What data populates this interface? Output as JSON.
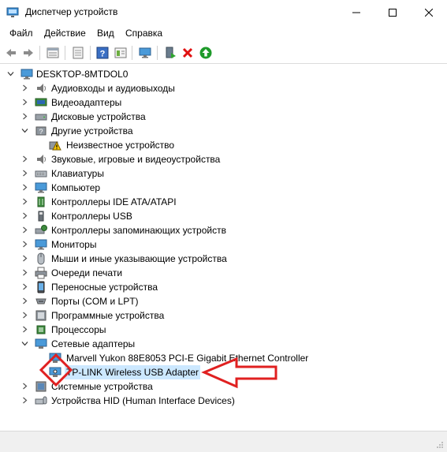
{
  "window": {
    "title": "Диспетчер устройств",
    "controls": [
      "minimize",
      "maximize",
      "close"
    ]
  },
  "menu": [
    "Файл",
    "Действие",
    "Вид",
    "Справка"
  ],
  "toolbar": [
    "back-icon",
    "forward-icon",
    "properties-icon",
    "update-driver-icon",
    "help-icon",
    "view-icon",
    "monitor-icon",
    "scan-hardware-icon",
    "uninstall-icon",
    "enable-device-icon"
  ],
  "tree": {
    "root": "DESKTOP-8MTDOL0",
    "items": [
      {
        "label": "Аудиовходы и аудиовыходы",
        "icon": "audio-icon",
        "expanded": false
      },
      {
        "label": "Видеоадаптеры",
        "icon": "display-adapter-icon",
        "expanded": false
      },
      {
        "label": "Дисковые устройства",
        "icon": "disk-icon",
        "expanded": false
      },
      {
        "label": "Другие устройства",
        "icon": "other-devices-icon",
        "expanded": true,
        "children": [
          {
            "label": "Неизвестное устройство",
            "icon": "warning-device-icon"
          }
        ]
      },
      {
        "label": "Звуковые, игровые и видеоустройства",
        "icon": "sound-icon",
        "expanded": false
      },
      {
        "label": "Клавиатуры",
        "icon": "keyboard-icon",
        "expanded": false
      },
      {
        "label": "Компьютер",
        "icon": "computer-icon",
        "expanded": false
      },
      {
        "label": "Контроллеры IDE ATA/ATAPI",
        "icon": "ide-icon",
        "expanded": false
      },
      {
        "label": "Контроллеры USB",
        "icon": "usb-icon",
        "expanded": false
      },
      {
        "label": "Контроллеры запоминающих устройств",
        "icon": "storage-icon",
        "expanded": false
      },
      {
        "label": "Мониторы",
        "icon": "monitor-icon",
        "expanded": false
      },
      {
        "label": "Мыши и иные указывающие устройства",
        "icon": "mouse-icon",
        "expanded": false
      },
      {
        "label": "Очереди печати",
        "icon": "printer-icon",
        "expanded": false
      },
      {
        "label": "Переносные устройства",
        "icon": "portable-icon",
        "expanded": false
      },
      {
        "label": "Порты (COM и LPT)",
        "icon": "port-icon",
        "expanded": false
      },
      {
        "label": "Программные устройства",
        "icon": "software-icon",
        "expanded": false
      },
      {
        "label": "Процессоры",
        "icon": "cpu-icon",
        "expanded": false
      },
      {
        "label": "Сетевые адаптеры",
        "icon": "network-icon",
        "expanded": true,
        "children": [
          {
            "label": "Marvell Yukon 88E8053 PCI-E Gigabit Ethernet Controller",
            "icon": "network-card-icon"
          },
          {
            "label": "TP-LINK Wireless USB Adapter",
            "icon": "network-card-icon",
            "selected": true
          }
        ]
      },
      {
        "label": "Системные устройства",
        "icon": "system-icon",
        "expanded": false
      },
      {
        "label": "Устройства HID (Human Interface Devices)",
        "icon": "hid-icon",
        "expanded": false
      }
    ]
  },
  "annotation": {
    "color": "#e02020"
  }
}
